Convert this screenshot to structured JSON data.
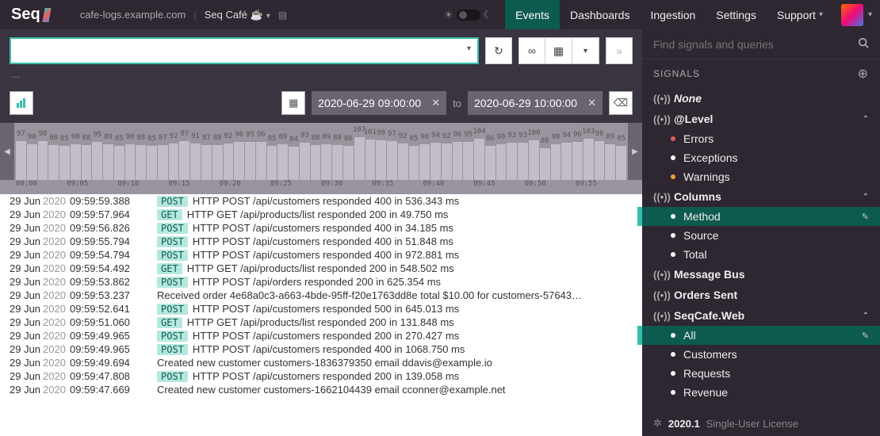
{
  "header": {
    "logo": "Seq",
    "host": "cafe-logs.example.com",
    "workspace": "Seq Café ☕",
    "nav": [
      "Events",
      "Dashboards",
      "Ingestion",
      "Settings",
      "Support"
    ],
    "active_nav": "Events"
  },
  "query": {
    "value": "",
    "status": "…"
  },
  "timerange": {
    "from": "2020-06-29 09:00:00",
    "to_label": "to",
    "to": "2020-06-29 10:00:00"
  },
  "histogram": {
    "values": [
      97,
      90,
      98,
      88,
      85,
      90,
      88,
      95,
      89,
      85,
      90,
      88,
      85,
      87,
      92,
      97,
      91,
      87,
      88,
      92,
      96,
      95,
      96,
      85,
      89,
      84,
      93,
      88,
      89,
      88,
      86,
      107,
      101,
      99,
      97,
      92,
      85,
      90,
      94,
      92,
      96,
      95,
      104,
      86,
      90,
      93,
      93,
      100,
      80,
      90,
      94,
      96,
      103,
      98,
      89,
      85
    ],
    "ticks": [
      "09:00",
      "09:05",
      "09:10",
      "09:15",
      "09:20",
      "09:25",
      "09:30",
      "09:35",
      "09:40",
      "09:45",
      "09:50",
      "09:55"
    ]
  },
  "events": [
    {
      "d1": "29 Jun",
      "d2": "2020",
      "t": "09:59:59.388",
      "tag": "POST",
      "msg": "HTTP POST /api/customers responded 400 in 536.343 ms"
    },
    {
      "d1": "29 Jun",
      "d2": "2020",
      "t": "09:59:57.964",
      "tag": "GET",
      "msg": "HTTP GET /api/products/list responded 200 in 49.750 ms"
    },
    {
      "d1": "29 Jun",
      "d2": "2020",
      "t": "09:59:56.826",
      "tag": "POST",
      "msg": "HTTP POST /api/customers responded 400 in 34.185 ms"
    },
    {
      "d1": "29 Jun",
      "d2": "2020",
      "t": "09:59:55.794",
      "tag": "POST",
      "msg": "HTTP POST /api/customers responded 400 in 51.848 ms"
    },
    {
      "d1": "29 Jun",
      "d2": "2020",
      "t": "09:59:54.794",
      "tag": "POST",
      "msg": "HTTP POST /api/customers responded 400 in 972.881 ms"
    },
    {
      "d1": "29 Jun",
      "d2": "2020",
      "t": "09:59:54.492",
      "tag": "GET",
      "msg": "HTTP GET /api/products/list responded 200 in 548.502 ms"
    },
    {
      "d1": "29 Jun",
      "d2": "2020",
      "t": "09:59:53.862",
      "tag": "POST",
      "msg": "HTTP POST /api/orders responded 200 in 625.354 ms"
    },
    {
      "d1": "29 Jun",
      "d2": "2020",
      "t": "09:59:53.237",
      "tag": "",
      "msg": "Received order 4e68a0c3-a663-4bde-95ff-f20e1763dd8e total $10.00 for customers-57643…"
    },
    {
      "d1": "29 Jun",
      "d2": "2020",
      "t": "09:59:52.641",
      "tag": "POST",
      "msg": "HTTP POST /api/customers responded 500 in 645.013 ms"
    },
    {
      "d1": "29 Jun",
      "d2": "2020",
      "t": "09:59:51.060",
      "tag": "GET",
      "msg": "HTTP GET /api/products/list responded 200 in 131.848 ms"
    },
    {
      "d1": "29 Jun",
      "d2": "2020",
      "t": "09:59:49.965",
      "tag": "POST",
      "msg": "HTTP POST /api/customers responded 200 in 270.427 ms"
    },
    {
      "d1": "29 Jun",
      "d2": "2020",
      "t": "09:59:49.965",
      "tag": "POST",
      "msg": "HTTP POST /api/customers responded 400 in 1068.750 ms"
    },
    {
      "d1": "29 Jun",
      "d2": "2020",
      "t": "09:59:49.694",
      "tag": "",
      "msg": "Created new customer customers-1836379350 email ddavis@example.io"
    },
    {
      "d1": "29 Jun",
      "d2": "2020",
      "t": "09:59:47.808",
      "tag": "POST",
      "msg": "HTTP POST /api/customers responded 200 in 139.058 ms"
    },
    {
      "d1": "29 Jun",
      "d2": "2020",
      "t": "09:59:47.669",
      "tag": "",
      "msg": "Created new customer customers-1662104439 email cconner@example.net"
    }
  ],
  "sidebar": {
    "search_placeholder": "Find signals and queries",
    "signals_label": "SIGNALS",
    "groups": [
      {
        "icon": "sig",
        "name": "None",
        "italic": true,
        "expandable": false
      },
      {
        "icon": "sig",
        "name": "@Level",
        "italic": false,
        "expandable": true,
        "children": [
          {
            "dot": "r",
            "label": "Errors"
          },
          {
            "dot": "w",
            "label": "Exceptions"
          },
          {
            "dot": "o",
            "label": "Warnings"
          }
        ]
      },
      {
        "icon": "sig",
        "name": "Columns",
        "italic": false,
        "expandable": true,
        "children": [
          {
            "dot": "w",
            "label": "Method",
            "selected": true
          },
          {
            "dot": "w",
            "label": "Source"
          },
          {
            "dot": "w",
            "label": "Total"
          }
        ]
      },
      {
        "icon": "sig",
        "name": "Message Bus",
        "italic": false,
        "expandable": false
      },
      {
        "icon": "sig",
        "name": "Orders Sent",
        "italic": false,
        "expandable": false
      },
      {
        "icon": "sig",
        "name": "SeqCafe.Web",
        "italic": false,
        "expandable": true,
        "children": [
          {
            "dot": "w",
            "label": "All",
            "selected": true
          },
          {
            "dot": "w",
            "label": "Customers"
          },
          {
            "dot": "w",
            "label": "Requests"
          },
          {
            "dot": "w",
            "label": "Revenue"
          }
        ]
      }
    ],
    "footer_version": "2020.1",
    "footer_license": "Single-User License"
  }
}
